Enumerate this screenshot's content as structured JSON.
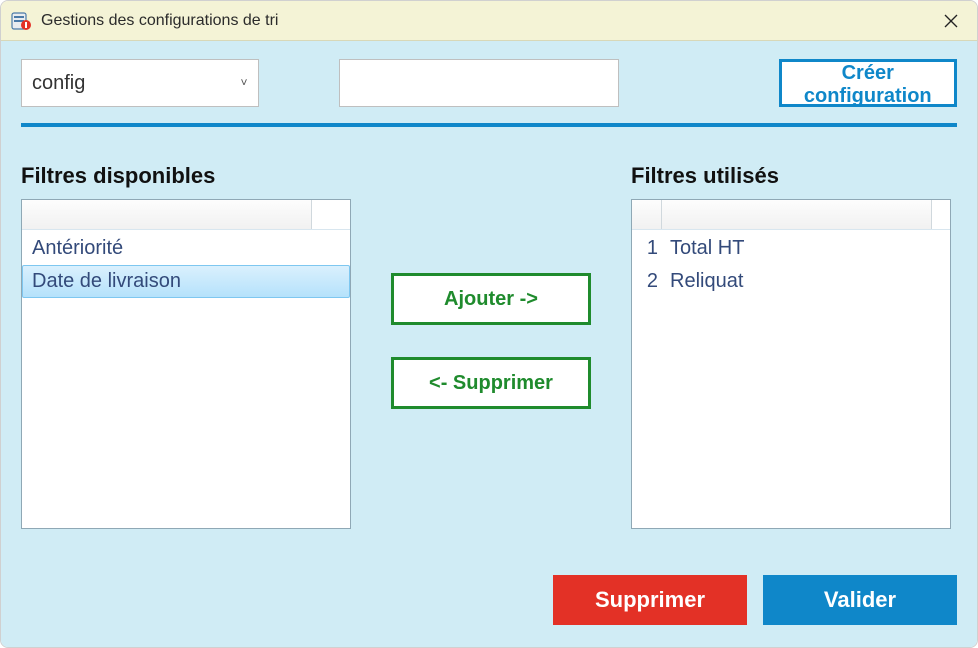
{
  "window": {
    "title": "Gestions des configurations de tri"
  },
  "top": {
    "config_selected": "config",
    "name_value": "",
    "create_label": "Créer configuration"
  },
  "lists": {
    "available_title": "Filtres disponibles",
    "used_title": "Filtres utilisés",
    "available": [
      {
        "label": "Antériorité",
        "selected": false
      },
      {
        "label": "Date de livraison",
        "selected": true
      }
    ],
    "used": [
      {
        "index": "1",
        "label": "Total HT"
      },
      {
        "index": "2",
        "label": "Reliquat"
      }
    ]
  },
  "buttons": {
    "add": "Ajouter ->",
    "remove": "<- Supprimer",
    "delete": "Supprimer",
    "validate": "Valider"
  }
}
